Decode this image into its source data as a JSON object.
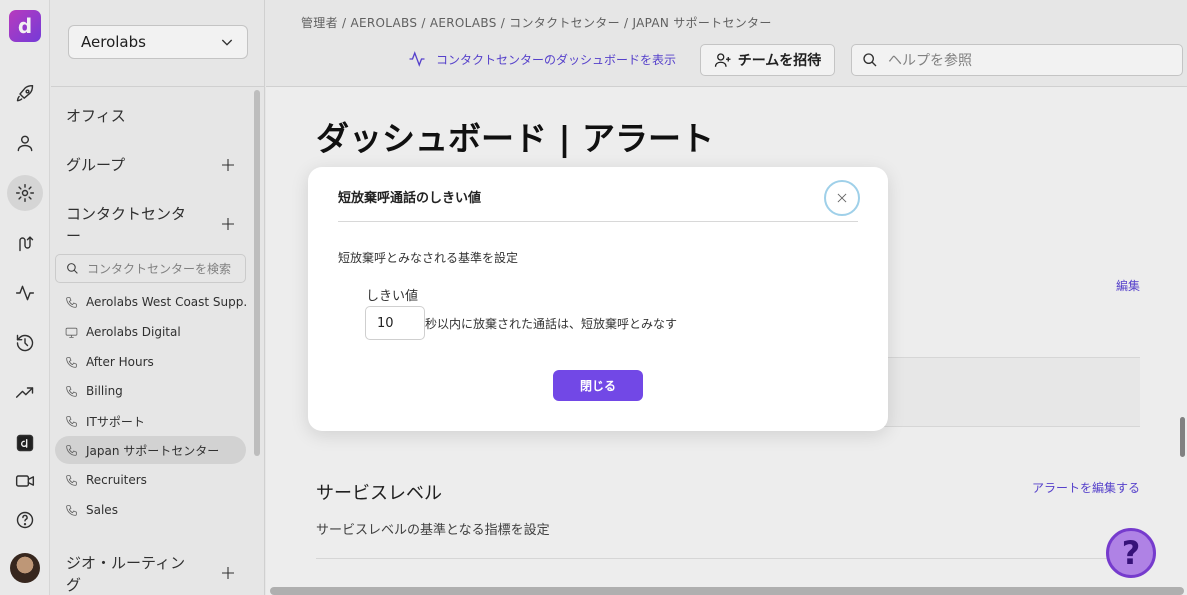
{
  "rail": {
    "logo_letter": "d",
    "items": [
      "rocket-icon",
      "person-icon",
      "gear-icon",
      "route-icon",
      "activity-icon",
      "history-icon",
      "trending-icon",
      "app-logo-icon",
      "video-icon",
      "help-icon"
    ]
  },
  "sidebar": {
    "org_name": "Aerolabs",
    "sections": {
      "office": "オフィス",
      "groups": "グループ",
      "contact_center": "コンタクトセンター",
      "geo_routing": "ジオ・ルーティング"
    },
    "search_placeholder": "コンタクトセンターを検索",
    "items": [
      {
        "label": "Aerolabs West Coast Supp...",
        "icon": "phone-icon"
      },
      {
        "label": "Aerolabs Digital",
        "icon": "monitor-icon"
      },
      {
        "label": "After Hours",
        "icon": "phone-icon"
      },
      {
        "label": "Billing",
        "icon": "phone-icon"
      },
      {
        "label": "ITサポート",
        "icon": "phone-icon"
      },
      {
        "label": "Japan サポートセンター",
        "icon": "phone-icon",
        "active": true
      },
      {
        "label": "Recruiters",
        "icon": "phone-icon"
      },
      {
        "label": "Sales",
        "icon": "phone-icon"
      }
    ]
  },
  "header": {
    "breadcrumb": "管理者 / AEROLABS / AEROLABS / コンタクトセンター / JAPAN サポートセンター",
    "dashboard_link": "コンタクトセンターのダッシュボードを表示",
    "invite_label": "チームを招待",
    "help_placeholder": "ヘルプを参照"
  },
  "main": {
    "title": "ダッシュボード | アラート",
    "edit_label": "編集",
    "service_level": {
      "title": "サービスレベル",
      "edit_alerts": "アラートを編集する",
      "description": "サービスレベルの基準となる指標を設定"
    },
    "help_fab": "?"
  },
  "modal": {
    "title": "短放棄呼通話のしきい値",
    "description": "短放棄呼とみなされる基準を設定",
    "threshold_label": "しきい値",
    "threshold_value": "10",
    "threshold_suffix": "秒以内に放棄された通話は、短放棄呼とみなす",
    "close_label": "閉じる"
  }
}
